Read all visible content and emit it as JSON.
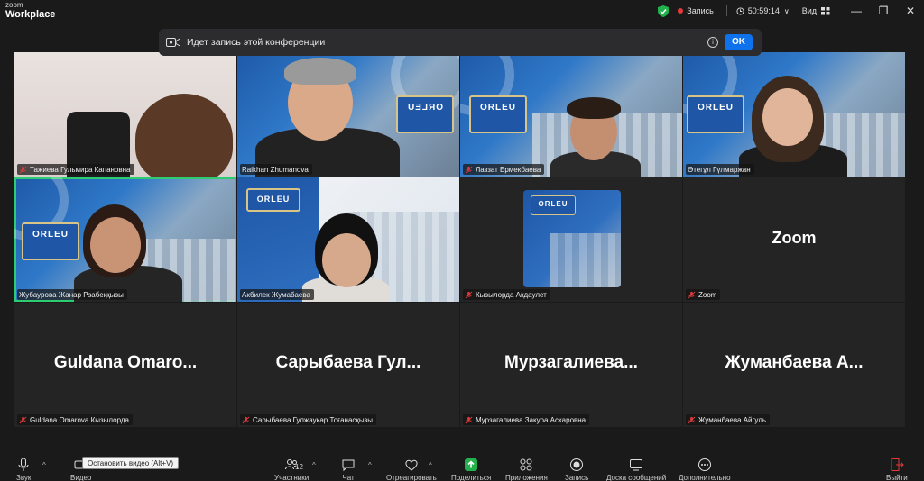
{
  "titlebar": {
    "brand_line1": "zoom",
    "brand_line2": "Workplace",
    "record_label": "Запись",
    "timer": "50:59:14",
    "view_label": "Вид",
    "minimize": "—",
    "restore": "❐",
    "close": "✕"
  },
  "banner": {
    "text": "Идет запись этой конференции",
    "info_glyph": "i",
    "ok_label": "OK"
  },
  "orleu_text": "ORLEU",
  "participants": [
    {
      "name": "Тажиева Гульмира Капановна",
      "muted": true,
      "video": true
    },
    {
      "name": "Raikhan Zhumanova",
      "muted": false,
      "video": true
    },
    {
      "name": "Лаззат Ермекбаева",
      "muted": true,
      "video": true
    },
    {
      "name": "Өтегұл Гүлмаржан",
      "muted": false,
      "video": true
    },
    {
      "name": "Жубаурова Жанар Рзабеққызы",
      "muted": false,
      "video": true,
      "active": true
    },
    {
      "name": "Акбилек Жумабаева",
      "muted": false,
      "video": true
    },
    {
      "name": "Кызылорда Акдаулет",
      "muted": true,
      "video": true
    },
    {
      "name": "Zoom",
      "muted": true,
      "video": false,
      "display": "Zoom"
    },
    {
      "name": "Guldana Omarova Кызылорда",
      "muted": true,
      "video": false,
      "display": "Guldana  Omaro..."
    },
    {
      "name": "Сарыбаева Гулжаукар Тоғанасқызы",
      "muted": true,
      "video": false,
      "display": "Сарыбаева  Гул..."
    },
    {
      "name": "Мурзагалиева Закура Аскаровна",
      "muted": true,
      "video": false,
      "display": "Мурзагалиева..."
    },
    {
      "name": "Жуманбаева Айгуль",
      "muted": true,
      "video": false,
      "display": "Жуманбаева  А..."
    }
  ],
  "toolbar": {
    "audio_label": "Звук",
    "video_label": "Видео",
    "tooltip": "Остановить видео (Alt+V)",
    "participants_count": "12",
    "participants_label": "Участники",
    "chat_label": "Чат",
    "reactions_label": "Отреагировать",
    "share_label": "Поделиться",
    "apps_label": "Приложения",
    "record_label": "Запись",
    "captions_label": "Доска сообщений",
    "more_label": "Дополнительно",
    "leave_label": "Выйти",
    "caret": "^"
  }
}
